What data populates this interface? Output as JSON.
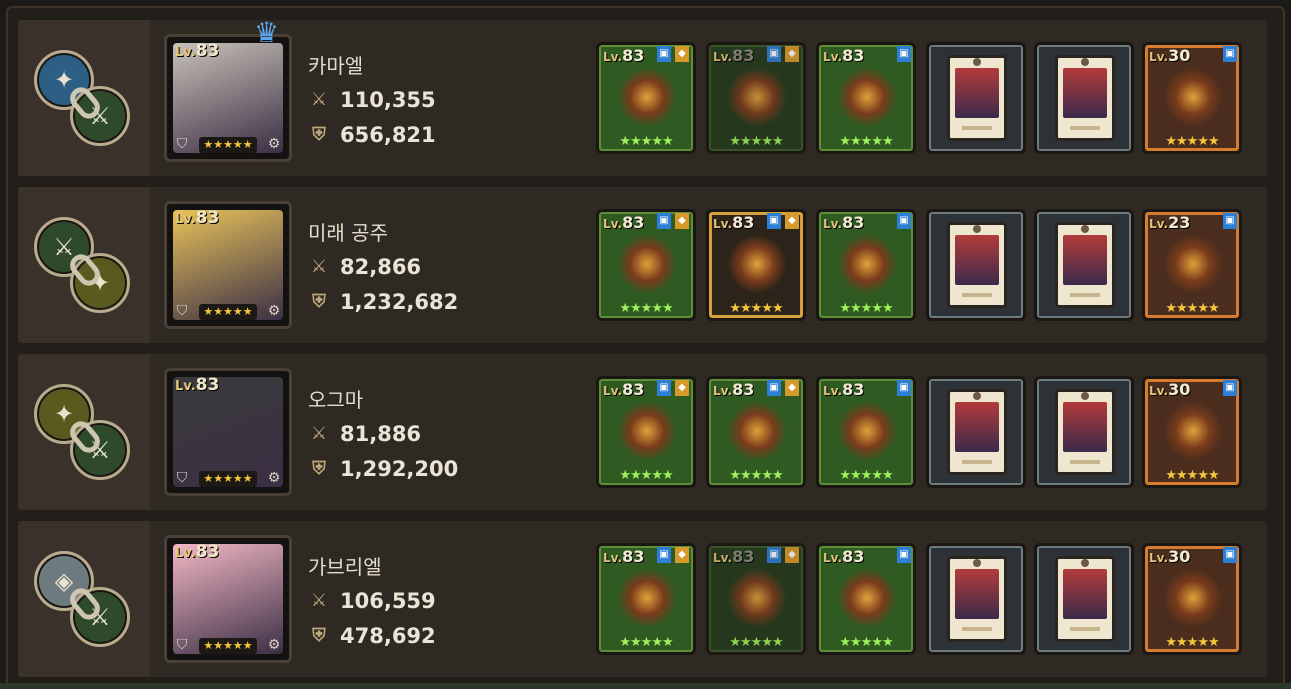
{
  "heroes": [
    {
      "name": "카마엘",
      "level": "83",
      "attack": "110,355",
      "defense": "656,821",
      "crown": true,
      "equipment": [
        {
          "type": "weapon",
          "level": "83",
          "style": "green"
        },
        {
          "type": "weapon",
          "level": "83",
          "style": "dim"
        },
        {
          "type": "accessory",
          "level": "83",
          "style": "green"
        },
        {
          "type": "card",
          "style": "card"
        },
        {
          "type": "card",
          "style": "card"
        },
        {
          "type": "relic",
          "level": "30",
          "style": "orange"
        }
      ]
    },
    {
      "name": "미래 공주",
      "level": "83",
      "attack": "82,866",
      "defense": "1,232,682",
      "crown": false,
      "equipment": [
        {
          "type": "weapon",
          "level": "83",
          "style": "green"
        },
        {
          "type": "shield",
          "level": "83",
          "style": "gold"
        },
        {
          "type": "accessory",
          "level": "83",
          "style": "green"
        },
        {
          "type": "card",
          "style": "card"
        },
        {
          "type": "card",
          "style": "card"
        },
        {
          "type": "relic",
          "level": "23",
          "style": "orange"
        }
      ]
    },
    {
      "name": "오그마",
      "level": "83",
      "attack": "81,886",
      "defense": "1,292,200",
      "crown": false,
      "equipment": [
        {
          "type": "weapon",
          "level": "83",
          "style": "green"
        },
        {
          "type": "shield",
          "level": "83",
          "style": "green"
        },
        {
          "type": "accessory",
          "level": "83",
          "style": "green"
        },
        {
          "type": "card",
          "style": "card"
        },
        {
          "type": "card",
          "style": "card"
        },
        {
          "type": "relic",
          "level": "30",
          "style": "orange"
        }
      ]
    },
    {
      "name": "가브리엘",
      "level": "83",
      "attack": "106,559",
      "defense": "478,692",
      "crown": false,
      "equipment": [
        {
          "type": "weapon",
          "level": "83",
          "style": "green"
        },
        {
          "type": "weapon",
          "level": "83",
          "style": "dim"
        },
        {
          "type": "accessory",
          "level": "83",
          "style": "green"
        },
        {
          "type": "card",
          "style": "card"
        },
        {
          "type": "card",
          "style": "card"
        },
        {
          "type": "relic",
          "level": "30",
          "style": "orange"
        }
      ]
    }
  ],
  "labels": {
    "lv_prefix": "Lv."
  },
  "colors": {
    "chain_top": [
      "#2d5f86",
      "#2e4a2a",
      "#5a5a1e",
      "#6d7a80"
    ],
    "chain_bot": [
      "#2e4a2a",
      "#5a5a1e",
      "#2e4a2a",
      "#2e4a2a"
    ],
    "portrait_art": [
      "#c9c2b8",
      "#e8c35a",
      "#3a3a3a",
      "#f2b7c4"
    ]
  }
}
